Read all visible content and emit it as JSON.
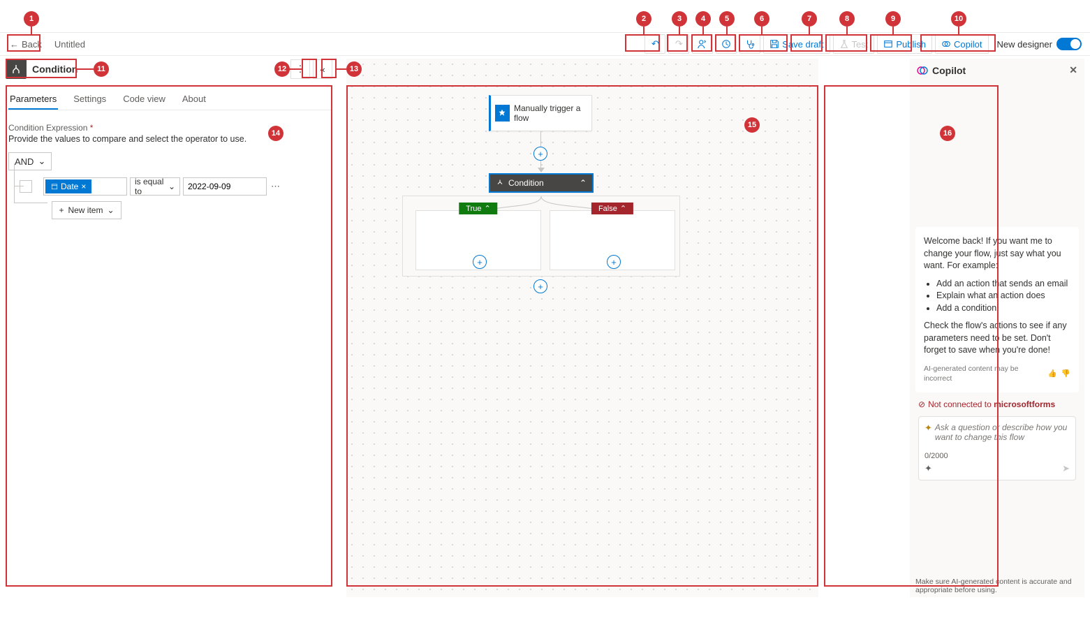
{
  "markers": [
    "1",
    "2",
    "3",
    "4",
    "5",
    "6",
    "7",
    "8",
    "9",
    "10",
    "11",
    "12",
    "13",
    "14",
    "15",
    "16"
  ],
  "topbar": {
    "back": "Back",
    "title": "Untitled",
    "save_draft": "Save draft",
    "test": "Test",
    "publish": "Publish",
    "copilot": "Copilot",
    "new_designer": "New designer"
  },
  "panel": {
    "title": "Condition",
    "tabs": [
      "Parameters",
      "Settings",
      "Code view",
      "About"
    ],
    "field_label": "Condition Expression",
    "field_help": "Provide the values to compare and select the operator to use.",
    "and": "AND",
    "token": "Date",
    "operator": "is equal to",
    "value": "2022-09-09",
    "new_item": "New item"
  },
  "canvas": {
    "trigger": "Manually trigger a flow",
    "condition": "Condition",
    "true": "True",
    "false": "False"
  },
  "copilot": {
    "title": "Copilot",
    "welcome": "Welcome back! If you want me to change your flow, just say what you want. For example:",
    "examples": [
      "Add an action that sends an email",
      "Explain what an action does",
      "Add a condition"
    ],
    "check": "Check the flow's actions to see if any parameters need to be set. Don't forget to save when you're done!",
    "disclaimer": "AI-generated content may be incorrect",
    "not_connected_prefix": "Not connected to ",
    "not_connected_target": "microsoftforms",
    "placeholder": "Ask a question or describe how you want to change this flow",
    "count": "0/2000",
    "footer": "Make sure AI-generated content is accurate and appropriate before using."
  }
}
